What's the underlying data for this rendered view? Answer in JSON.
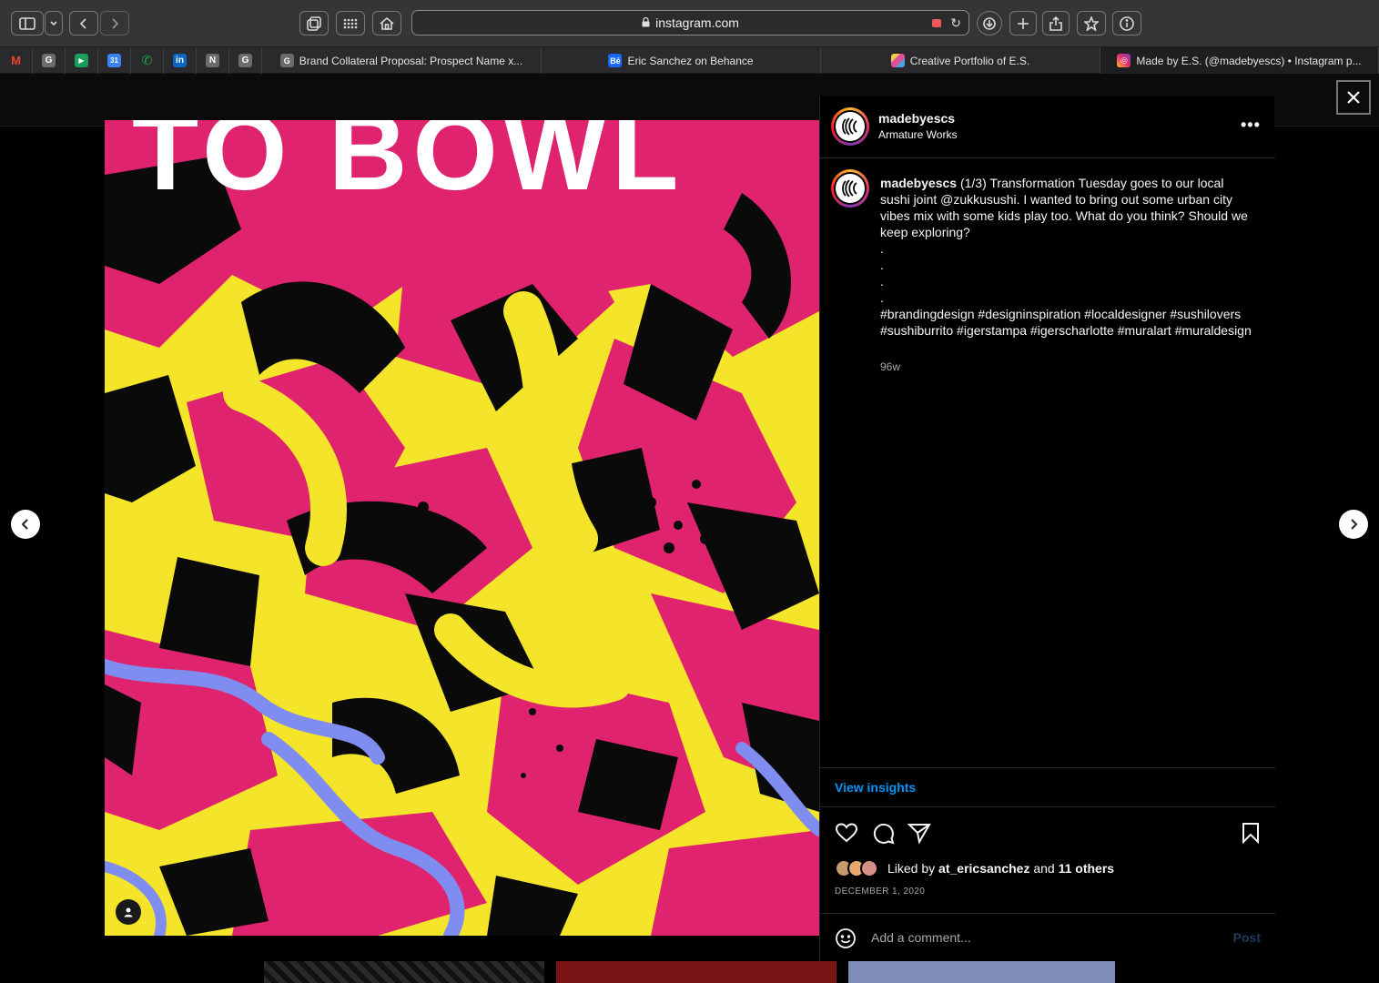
{
  "browser": {
    "url": "instagram.com",
    "pinned_tabs": [
      {
        "icon": "gmail-icon",
        "letter": "M",
        "color": "#ea4335"
      },
      {
        "icon": "google-doc-icon",
        "letter": "G",
        "color": "#6b6b6b"
      },
      {
        "icon": "google-meet-icon",
        "letter": "▶",
        "color": "#1a9e5a"
      },
      {
        "icon": "google-calendar-icon",
        "letter": "31",
        "color": "#3b82f6"
      },
      {
        "icon": "phone-icon",
        "letter": "✆",
        "color": "#22a34a"
      },
      {
        "icon": "linkedin-icon",
        "letter": "in",
        "color": "#0a66c2"
      },
      {
        "icon": "notion-icon",
        "letter": "N",
        "color": "#6b6b6b"
      },
      {
        "icon": "google-icon",
        "letter": "G",
        "color": "#6b6b6b"
      }
    ],
    "tabs": [
      {
        "title": "Brand Collateral Proposal: Prospect Name x...",
        "icon": "google-doc-icon",
        "letter": "G",
        "color": "#6b6b6b"
      },
      {
        "title": "Eric Sanchez on Behance",
        "icon": "behance-icon",
        "letter": "Bē",
        "color": "#1769ff"
      },
      {
        "title": "Creative Portfolio of E.S.",
        "icon": "portfolio-icon",
        "letter": "",
        "color": "#f2c94c"
      },
      {
        "title": "Made by E.S. (@madebyescs) • Instagram p...",
        "icon": "instagram-icon",
        "letter": "◎",
        "color": "#d6249f"
      }
    ]
  },
  "post": {
    "username": "madebyescs",
    "location": "Armature Works",
    "more": "•••",
    "caption_user": "madebyescs",
    "caption_text": "(1/3) Transformation Tuesday goes to our local sushi joint @zukkusushi. I wanted to bring out some urban city vibes mix with some kids play too. What do you think? Should we keep exploring?",
    "dots": [
      ".",
      ".",
      ".",
      "."
    ],
    "hashtags": "#brandingdesign #designinspiration #localdesigner #sushilovers #sushiburrito #igerstampa #igerscharlotte #muralart #muraldesign",
    "age": "96w",
    "insights_label": "View insights",
    "liked_by_prefix": "Liked by",
    "liked_by_user": "at_ericsanchez",
    "liked_by_and": "and",
    "liked_by_others": "11 others",
    "date": "DECEMBER 1, 2020",
    "comment_placeholder": "Add a comment...",
    "post_label": "Post",
    "image_text": "TO BOWL"
  },
  "colors": {
    "accent_blue": "#0095f6",
    "art_yellow": "#f5e52a",
    "art_pink": "#e0236f",
    "art_black": "#0a0a0a",
    "art_blue": "#7f8df0"
  }
}
